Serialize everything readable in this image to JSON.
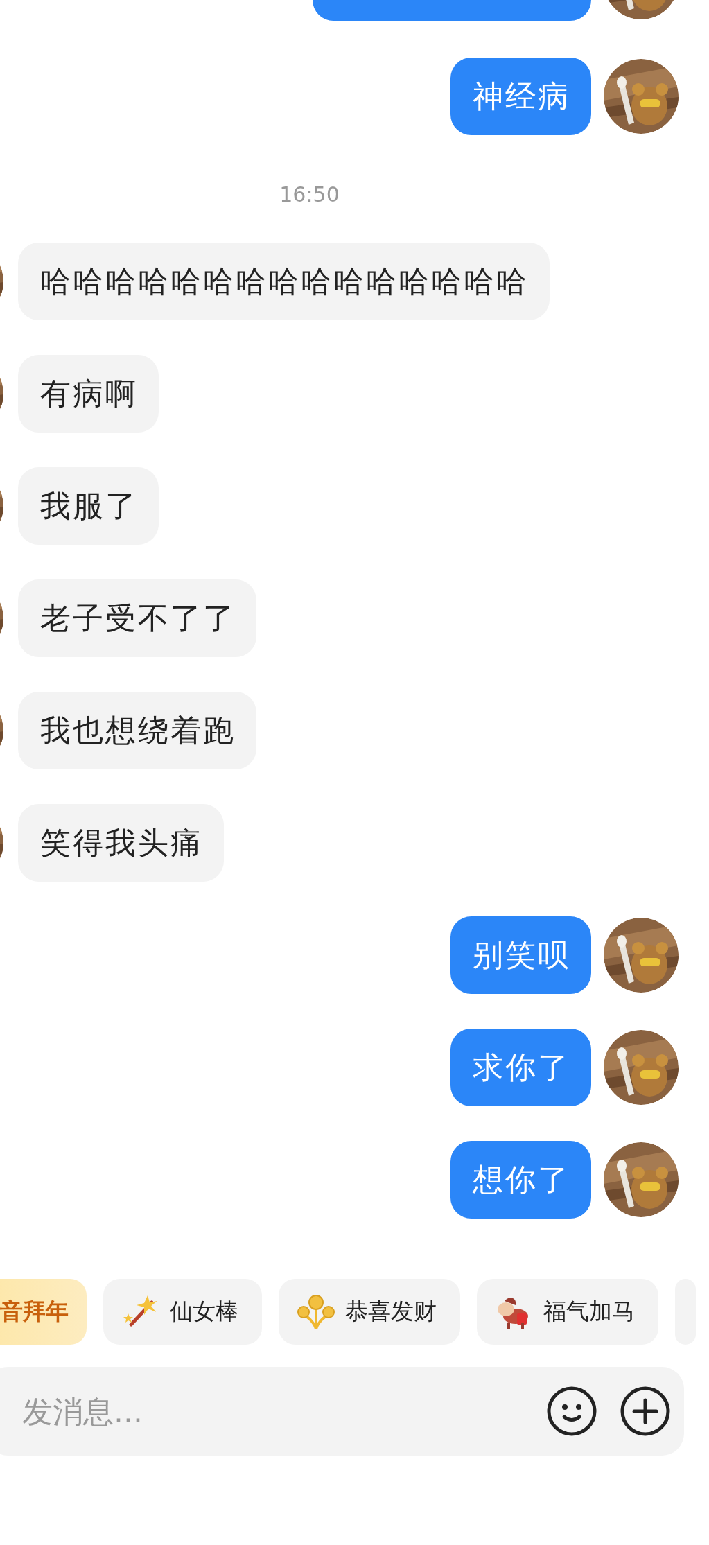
{
  "messages": [
    {
      "kind": "cut",
      "outgoing": true
    },
    {
      "kind": "bubble",
      "outgoing": true,
      "text": "神经病"
    },
    {
      "kind": "time",
      "text": "16:50"
    },
    {
      "kind": "bubble",
      "outgoing": false,
      "text": "哈哈哈哈哈哈哈哈哈哈哈哈哈哈哈"
    },
    {
      "kind": "bubble",
      "outgoing": false,
      "text": "有病啊"
    },
    {
      "kind": "bubble",
      "outgoing": false,
      "text": "我服了"
    },
    {
      "kind": "bubble",
      "outgoing": false,
      "text": "老子受不了了"
    },
    {
      "kind": "bubble",
      "outgoing": false,
      "text": "我也想绕着跑"
    },
    {
      "kind": "bubble",
      "outgoing": false,
      "text": "笑得我头痛"
    },
    {
      "kind": "bubble",
      "outgoing": true,
      "text": "别笑呗"
    },
    {
      "kind": "bubble",
      "outgoing": true,
      "text": "求你了"
    },
    {
      "kind": "bubble",
      "outgoing": true,
      "text": "想你了"
    }
  ],
  "quick_replies": [
    {
      "kind": "highlight",
      "label": "音拜年"
    },
    {
      "kind": "normal",
      "label": "仙女棒"
    },
    {
      "kind": "normal",
      "label": "恭喜发财"
    },
    {
      "kind": "normal",
      "label": "福气加马"
    },
    {
      "kind": "cut"
    }
  ],
  "composer": {
    "placeholder": "发消息..."
  }
}
